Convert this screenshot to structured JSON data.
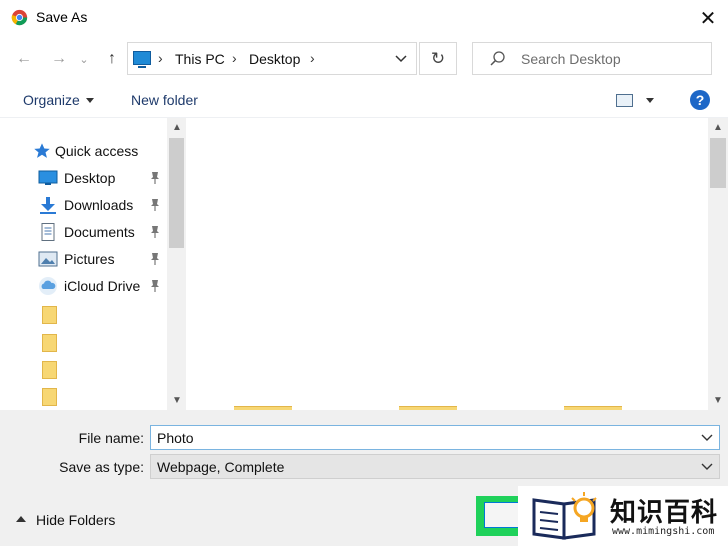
{
  "window": {
    "title": "Save As",
    "close_glyph": "✕"
  },
  "nav": {
    "back_glyph": "←",
    "forward_glyph": "→",
    "history_glyph": "⌄",
    "up_glyph": "↑",
    "breadcrumb": [
      "This PC",
      "Desktop"
    ],
    "crumb_separator": "›",
    "refresh_glyph": "↻",
    "search_placeholder": "Search Desktop"
  },
  "toolbar": {
    "organize_label": "Organize",
    "new_folder_label": "New folder",
    "help_glyph": "?"
  },
  "sidebar": {
    "items": [
      {
        "label": "Quick access",
        "icon": "star-icon"
      },
      {
        "label": "Desktop",
        "icon": "desktop-icon",
        "pinned": true
      },
      {
        "label": "Downloads",
        "icon": "download-icon",
        "pinned": true
      },
      {
        "label": "Documents",
        "icon": "documents-icon",
        "pinned": true
      },
      {
        "label": "Pictures",
        "icon": "pictures-icon",
        "pinned": true
      },
      {
        "label": "iCloud Drive",
        "icon": "icloud-icon",
        "pinned": true
      }
    ],
    "unlabeled_folders": 4
  },
  "form": {
    "file_name_label": "File name:",
    "file_name_value": "Photo",
    "save_type_label": "Save as type:",
    "save_type_value": "Webpage, Complete"
  },
  "footer": {
    "hide_folders_label": "Hide Folders"
  },
  "watermark": {
    "title": "知识百科",
    "url": "www.mimingshi.com"
  },
  "colors": {
    "accent": "#0078d7",
    "highlight": "#1fd15a",
    "help": "#1d67c7"
  }
}
